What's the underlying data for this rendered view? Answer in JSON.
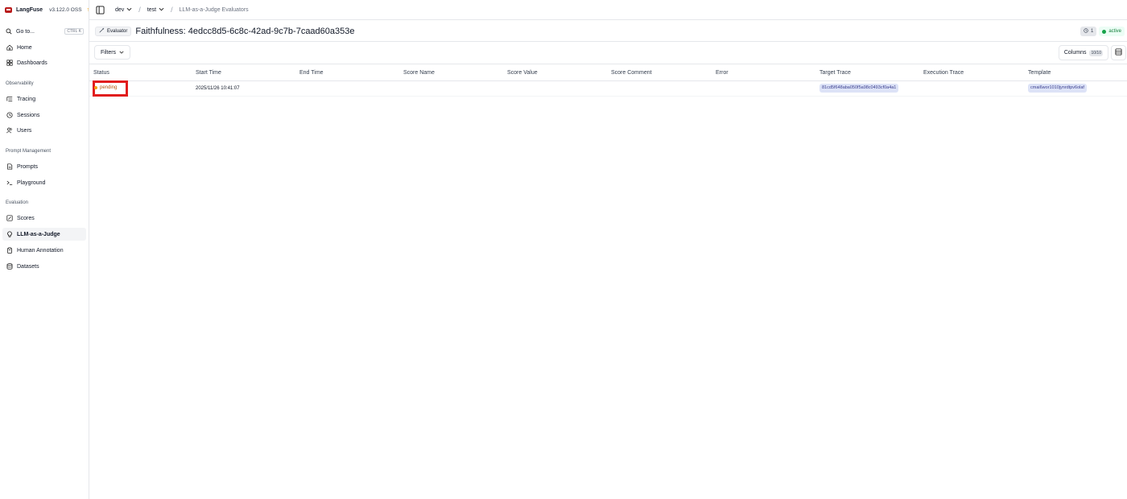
{
  "brand": {
    "name": "LangFuse",
    "version": "v3.122.0 OSS",
    "update_icon": "arrow-up-icon"
  },
  "sidebar": {
    "goto": {
      "label": "Go to...",
      "shortcut": "CTRL K"
    },
    "items_top": [
      {
        "label": "Home",
        "icon": "home-icon"
      },
      {
        "label": "Dashboards",
        "icon": "dashboard-icon"
      }
    ],
    "sections": [
      {
        "title": "Observability",
        "items": [
          {
            "label": "Tracing",
            "icon": "tracing-icon"
          },
          {
            "label": "Sessions",
            "icon": "clock-icon"
          },
          {
            "label": "Users",
            "icon": "users-icon"
          }
        ]
      },
      {
        "title": "Prompt Management",
        "items": [
          {
            "label": "Prompts",
            "icon": "file-icon"
          },
          {
            "label": "Playground",
            "icon": "terminal-icon"
          }
        ]
      },
      {
        "title": "Evaluation",
        "items": [
          {
            "label": "Scores",
            "icon": "score-icon"
          },
          {
            "label": "LLM-as-a-Judge",
            "icon": "lightbulb-icon",
            "active": true
          },
          {
            "label": "Human Annotation",
            "icon": "clipboard-icon"
          },
          {
            "label": "Datasets",
            "icon": "database-icon"
          }
        ]
      }
    ]
  },
  "breadcrumb": {
    "org": "dev",
    "project": "test",
    "page": "LLM-as-a-Judge Evaluators"
  },
  "header": {
    "badge": "Evaluator",
    "title": "Faithfulness: 4edcc8d5-6c8c-42ad-9c7b-7caad60a353e",
    "count": "1",
    "status": "active"
  },
  "toolbar": {
    "filters": "Filters",
    "columns": "Columns",
    "columns_count": "10/10"
  },
  "table": {
    "columns": [
      "Status",
      "Start Time",
      "End Time",
      "Score Name",
      "Score Value",
      "Score Comment",
      "Error",
      "Target Trace",
      "Execution Trace",
      "Template"
    ],
    "rows": [
      {
        "status": "pending",
        "start_time": "2025/11/26 10:41:07",
        "end_time": "",
        "score_name": "",
        "score_value": "",
        "score_comment": "",
        "error": "",
        "target_trace": "81cd5f648aba050f5a98c0493cf0a4a1",
        "execution_trace": "",
        "template": "cmai6wor1010jynrdtpv6olaf"
      }
    ]
  },
  "colors": {
    "accent_red": "#e11d1d",
    "pending": "#f59e0b",
    "active": "#15803d",
    "chip": "#dde3f7"
  }
}
